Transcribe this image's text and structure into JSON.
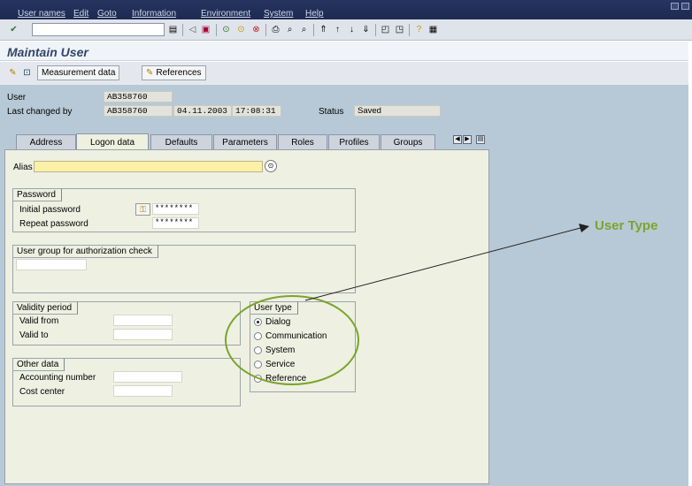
{
  "menu": [
    "User names",
    "Edit",
    "Goto",
    "Information",
    "Environment",
    "System",
    "Help"
  ],
  "title": "Maintain User",
  "app_toolbar": {
    "measurement": "Measurement data",
    "references": "References"
  },
  "header": {
    "user_label": "User",
    "user_value": "AB358760",
    "changed_label": "Last changed by",
    "changed_value": "AB358760",
    "date": "04.11.2003",
    "time": "17:08:31",
    "status_label": "Status",
    "status_value": "Saved"
  },
  "tabs": [
    "Address",
    "Logon data",
    "Defaults",
    "Parameters",
    "Roles",
    "Profiles",
    "Groups"
  ],
  "alias_label": "Alias",
  "password": {
    "title": "Password",
    "initial": "Initial password",
    "repeat": "Repeat password",
    "initial_value": "********",
    "repeat_value": "********"
  },
  "usergroup": {
    "title": "User group for authorization check"
  },
  "validity": {
    "title": "Validity period",
    "from": "Valid from",
    "to": "Valid to"
  },
  "other": {
    "title": "Other data",
    "accounting": "Accounting number",
    "cost": "Cost center"
  },
  "usertype": {
    "title": "User type",
    "options": [
      "Dialog",
      "Communication",
      "System",
      "Service",
      "Reference"
    ],
    "selected": "Dialog"
  },
  "annotation": {
    "label": "User Type",
    "color": "#7aa52a"
  },
  "colors": {
    "title": "#31466d",
    "bg": "#b7c9d6",
    "panel": "#eef0e2"
  }
}
